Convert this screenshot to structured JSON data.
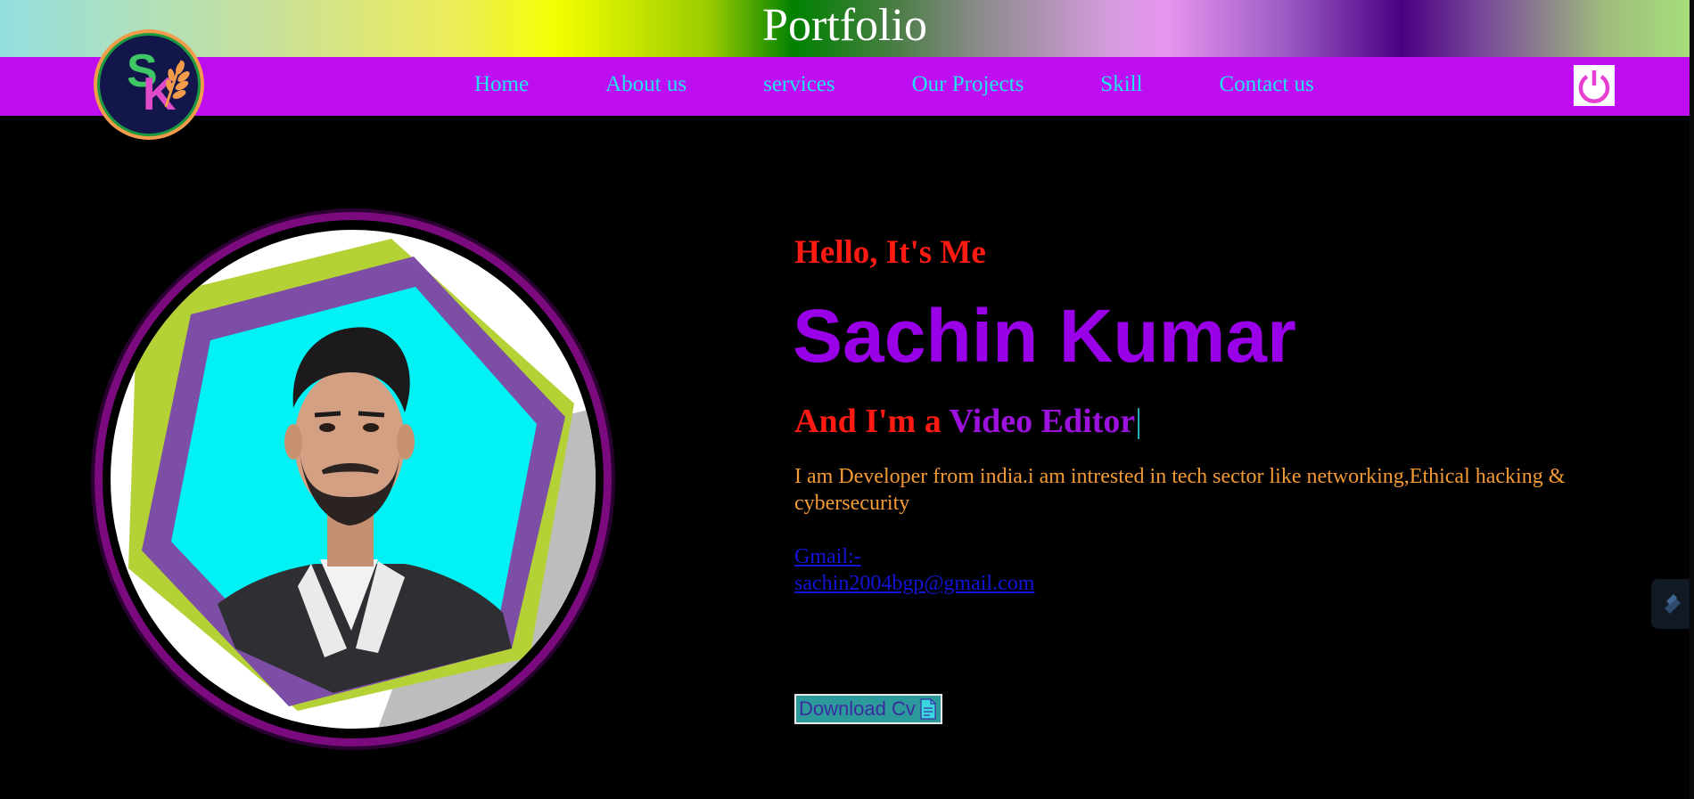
{
  "header": {
    "title": "Portfolio"
  },
  "logo": {
    "letter_s": "S",
    "letter_k": "K"
  },
  "nav": {
    "items": [
      {
        "label": "Home"
      },
      {
        "label": "About us"
      },
      {
        "label": "services"
      },
      {
        "label": "Our Projects"
      },
      {
        "label": "Skill"
      },
      {
        "label": "Contact us"
      }
    ]
  },
  "hero": {
    "greeting": "Hello, It's Me",
    "name": "Sachin Kumar",
    "role_prefix": "And I'm a ",
    "role": "Video Editor",
    "cursor": "|",
    "bio": "I am Developer from india.i am intrested in tech sector like networking,Ethical hacking & cybersecurity",
    "gmail_label": "Gmail:-",
    "gmail_address": "sachin2004bgp@gmail.com",
    "download_label": "Download Cv"
  },
  "colors": {
    "nav_bg": "#bd0df0",
    "nav_link": "#22e3f0",
    "greeting": "#ff1a12",
    "name": "#9a00e8",
    "bio": "#f39a35",
    "link": "#1414d8"
  },
  "icons": {
    "power": "power-icon",
    "document": "document-icon",
    "side_tab": "extension-icon"
  }
}
